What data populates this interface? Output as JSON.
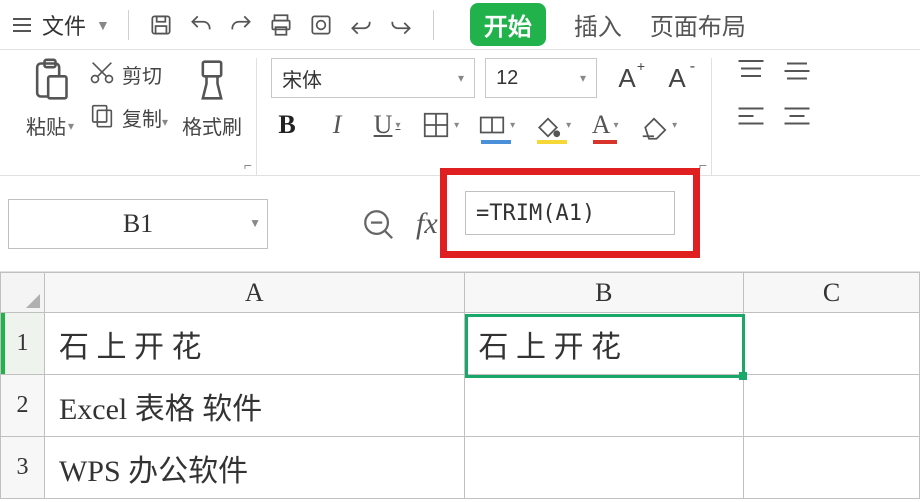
{
  "menu": {
    "file": "文件",
    "tabs": {
      "start": "开始",
      "insert": "插入",
      "pageLayout": "页面布局"
    }
  },
  "clipboard": {
    "paste": "粘贴",
    "cut": "剪切",
    "copy": "复制",
    "formatPainter": "格式刷"
  },
  "font": {
    "name": "宋体",
    "size": "12"
  },
  "formulaBar": {
    "cellRef": "B1",
    "formula": "=TRIM(A1)"
  },
  "grid": {
    "columns": [
      "A",
      "B",
      "C"
    ],
    "rows": [
      {
        "num": "1",
        "A": "石 上 开  花",
        "B": "石 上 开 花",
        "C": ""
      },
      {
        "num": "2",
        "A": "Excel  表格  软件",
        "B": "",
        "C": ""
      },
      {
        "num": "3",
        "A": "WPS  办公软件",
        "B": "",
        "C": ""
      }
    ]
  }
}
